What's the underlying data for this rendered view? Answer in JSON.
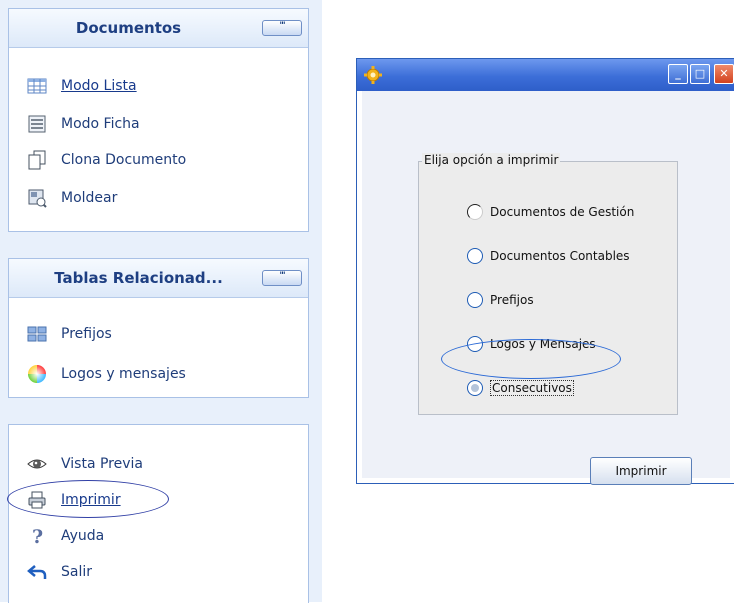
{
  "left_pane": {
    "documents": {
      "title": "Documentos",
      "menu_button": "'''",
      "items": [
        {
          "label": "Modo Lista",
          "icon": "grid-list-icon"
        },
        {
          "label": "Modo Ficha",
          "icon": "form-card-icon"
        },
        {
          "label": "Clona Documento",
          "icon": "copy-document-icon"
        },
        {
          "label": "Moldear",
          "icon": "template-icon"
        }
      ]
    },
    "related_tables": {
      "title": "Tablas Relacionad...",
      "menu_button": "'''",
      "items": [
        {
          "label": "Prefijos",
          "icon": "tiles-icon"
        },
        {
          "label": "Logos y mensajes",
          "icon": "color-wheel-icon"
        }
      ]
    },
    "actions": {
      "items": [
        {
          "label": "Vista Previa",
          "icon": "eye-icon"
        },
        {
          "label": "Imprimir",
          "icon": "printer-icon"
        },
        {
          "label": "Ayuda",
          "icon": "help-icon"
        },
        {
          "label": "Salir",
          "icon": "exit-arrow-icon"
        }
      ]
    }
  },
  "dialog": {
    "title": "",
    "window_buttons": {
      "minimize": "_",
      "maximize": "□",
      "close": "✕"
    },
    "group_label": "Elija opción a imprimir",
    "options": [
      "Documentos de Gestión",
      "Documentos Contables",
      "Prefijos",
      "Logos y Mensajes",
      "Consecutivos"
    ],
    "selected_option": "Consecutivos",
    "print_button": "Imprimir"
  },
  "colors": {
    "accent": "#2d6bd6",
    "pane_bg": "#e8f0fb",
    "title_text": "#1e3f82"
  }
}
